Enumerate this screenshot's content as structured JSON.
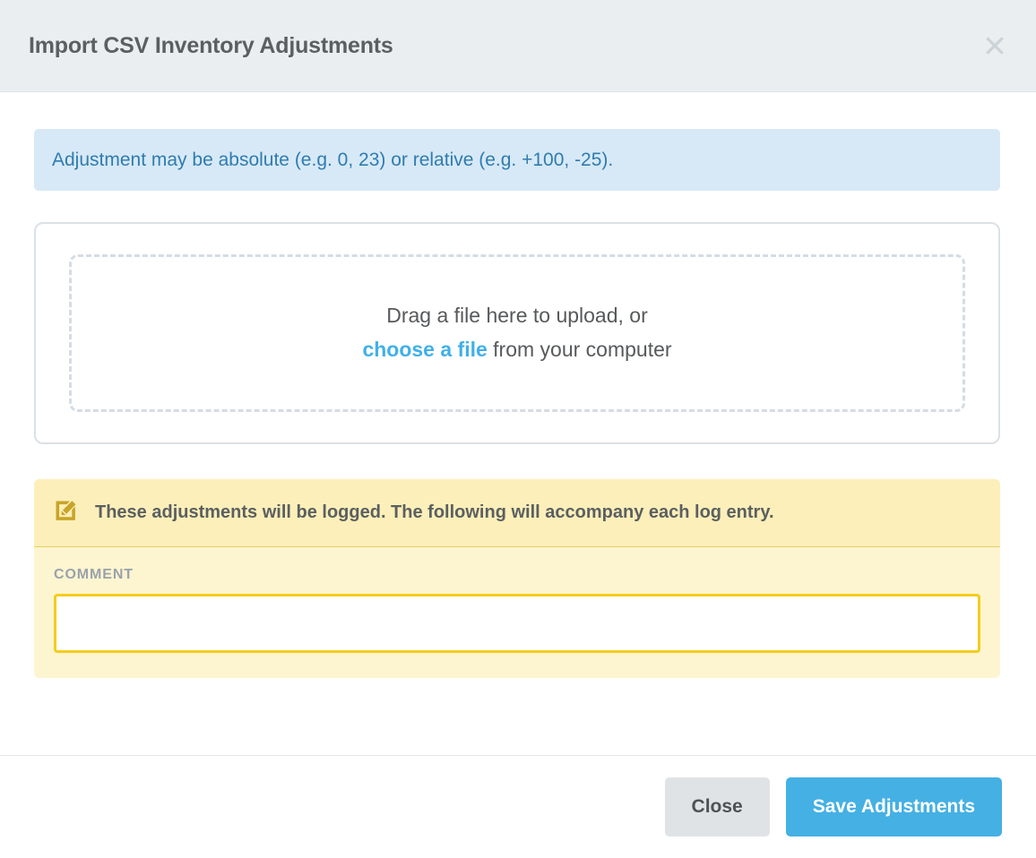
{
  "header": {
    "title": "Import CSV Inventory Adjustments",
    "close_icon": "close-icon"
  },
  "body": {
    "info_banner": {
      "text": "Adjustment may be absolute (e.g. 0, 23) or relative (e.g. +100, -25)."
    },
    "dropzone": {
      "line1": "Drag a file here to upload, or",
      "link": "choose a file",
      "line2_suffix": " from your computer"
    },
    "log_panel": {
      "icon": "pencil-square-icon",
      "notice": "These adjustments will be logged. The following will accompany each log entry.",
      "comment_label": "COMMENT",
      "comment_value": "",
      "comment_placeholder": ""
    }
  },
  "footer": {
    "close_label": "Close",
    "save_label": "Save Adjustments"
  },
  "colors": {
    "header_bg": "#eaeef0",
    "title_text": "#5b5f61",
    "info_bg": "#d7e9f6",
    "info_text": "#2f7cb0",
    "link_blue": "#41b0e8",
    "dropzone_border": "#dbe1e6",
    "dropzone_dashed": "#d5dce3",
    "log_panel_bg": "#fdf5d0",
    "log_header_bg": "#fcefb9",
    "log_border": "#e9d06a",
    "log_icon": "#c8a42a",
    "input_border": "#f5cc1c",
    "label_text": "#9aa3ab",
    "btn_close_bg": "#e0e3e6",
    "btn_save_bg": "#45b0e3"
  }
}
